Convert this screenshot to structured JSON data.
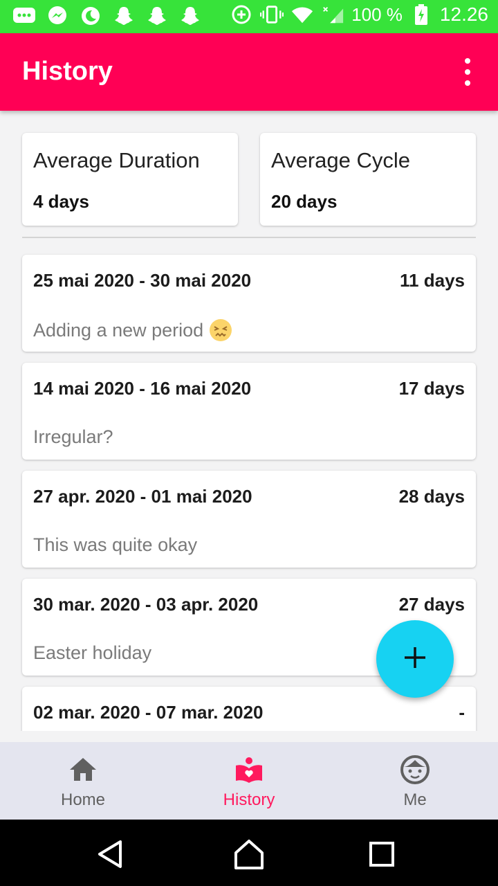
{
  "status_bar": {
    "battery": "100 %",
    "time": "12.26",
    "icons": [
      "sms-icon",
      "messenger-icon",
      "moon-icon",
      "snapchat-icon",
      "snapchat-icon",
      "snapchat-icon",
      "data-saver-icon",
      "vibrate-icon",
      "wifi-icon",
      "signal-icon",
      "battery-icon"
    ]
  },
  "appbar": {
    "title": "History",
    "overflow_icon": "more-vert-icon"
  },
  "stats": {
    "avg_duration_label": "Average Duration",
    "avg_duration_value": "4 days",
    "avg_cycle_label": "Average Cycle",
    "avg_cycle_value": "20 days"
  },
  "periods": [
    {
      "dates": "25 mai 2020 - 30 mai 2020",
      "length": "11 days",
      "note": "Adding a new period",
      "emoji": "confounded-face-emoji"
    },
    {
      "dates": "14 mai 2020 - 16 mai 2020",
      "length": "17 days",
      "note": "Irregular?"
    },
    {
      "dates": "27 apr. 2020 - 01 mai 2020",
      "length": "28 days",
      "note": "This was quite okay"
    },
    {
      "dates": "30 mar. 2020 - 03 apr. 2020",
      "length": "27 days",
      "note": "Easter holiday"
    },
    {
      "dates": "02 mar. 2020 - 07 mar. 2020",
      "length": "-",
      "note": ""
    }
  ],
  "fab": {
    "icon": "plus-icon"
  },
  "bottom_nav": {
    "items": [
      {
        "label": "Home",
        "icon": "home-icon",
        "active": false
      },
      {
        "label": "History",
        "icon": "book-heart-icon",
        "active": true
      },
      {
        "label": "Me",
        "icon": "face-icon",
        "active": false
      }
    ]
  },
  "colors": {
    "status_bar": "#37e33a",
    "app_bar": "#ff0055",
    "fab": "#17d2f2",
    "active_nav": "#ff1a5e",
    "nav_bg": "#e4e5ef"
  }
}
